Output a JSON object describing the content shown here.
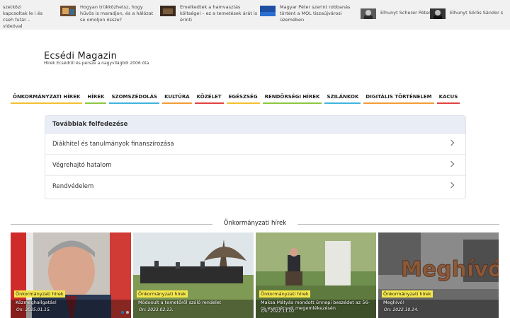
{
  "ticker": [
    {
      "text": "szetközi kapcsoltak le i és cseh futár – videóval",
      "thumb": false
    },
    {
      "text": "Hogyan trükközhetsz, hogy hűvös is maradjon, és a hálózat se omoljon össze?",
      "thumb": true
    },
    {
      "text": "Emelkedtek a hamvasztás költségei – ez a temetések árát is érinti",
      "thumb": true
    },
    {
      "text": "Magyar Péter szerint robbanás történt a MOL tiszaújvárosi üzemében",
      "thumb": true
    },
    {
      "text": "Elhunyt Scherer Péter",
      "thumb": true
    },
    {
      "text": "Elhunyt Sörös Sándor s",
      "thumb": true
    }
  ],
  "site": {
    "title": "Ecsédi Magazin",
    "description": "Hírek Ecsédről és persze a nagyvilágból 2006 óta"
  },
  "nav": [
    {
      "label": "ÖNKORMÁNYZATI HÍREK",
      "color": "#f2c12e"
    },
    {
      "label": "HÍREK",
      "color": "#8cc63f"
    },
    {
      "label": "SZOMSZÉDOLÁS",
      "color": "#3fb4e0"
    },
    {
      "label": "KULTÚRA",
      "color": "#f29d38"
    },
    {
      "label": "KÖZÉLET",
      "color": "#e2413f"
    },
    {
      "label": "EGÉSZSÉG",
      "color": "#f2c12e"
    },
    {
      "label": "RENDŐRSÉGI HÍREK",
      "color": "#8cc63f"
    },
    {
      "label": "SZILÁNKOK",
      "color": "#3fb4e0"
    },
    {
      "label": "DIGITÁLIS TÖRTÉNELEM",
      "color": "#f29d38"
    },
    {
      "label": "KACUS",
      "color": "#e2413f"
    }
  ],
  "explore": {
    "heading": "Továbbiak felfedezése",
    "items": [
      "Diákhitel és tanulmányok finanszírozása",
      "Végrehajtó hatalom",
      "Rendvédelem"
    ]
  },
  "section": {
    "title": "Önkormányzati hírek"
  },
  "cards": [
    {
      "category": "Önkormányzati hírek",
      "title": "Közmeghallgatás!",
      "date": "On: 2025.01.15."
    },
    {
      "category": "Önkormányzati hírek",
      "title": "Módosult a temetőről szóló rendelet",
      "date": "On: 2023.02.13."
    },
    {
      "category": "Önkormányzati hírek",
      "title": "Maksa Mátyás mondott ünnepi beszédet az 56-os események megemlékezésén",
      "date": "On: 2022.11.02."
    },
    {
      "category": "Önkormányzati hírek",
      "title": "Meghívó!",
      "date": "On: 2022.10.14."
    }
  ],
  "colors": {
    "badge": "#f7e84a",
    "accent": "#1e73be"
  }
}
